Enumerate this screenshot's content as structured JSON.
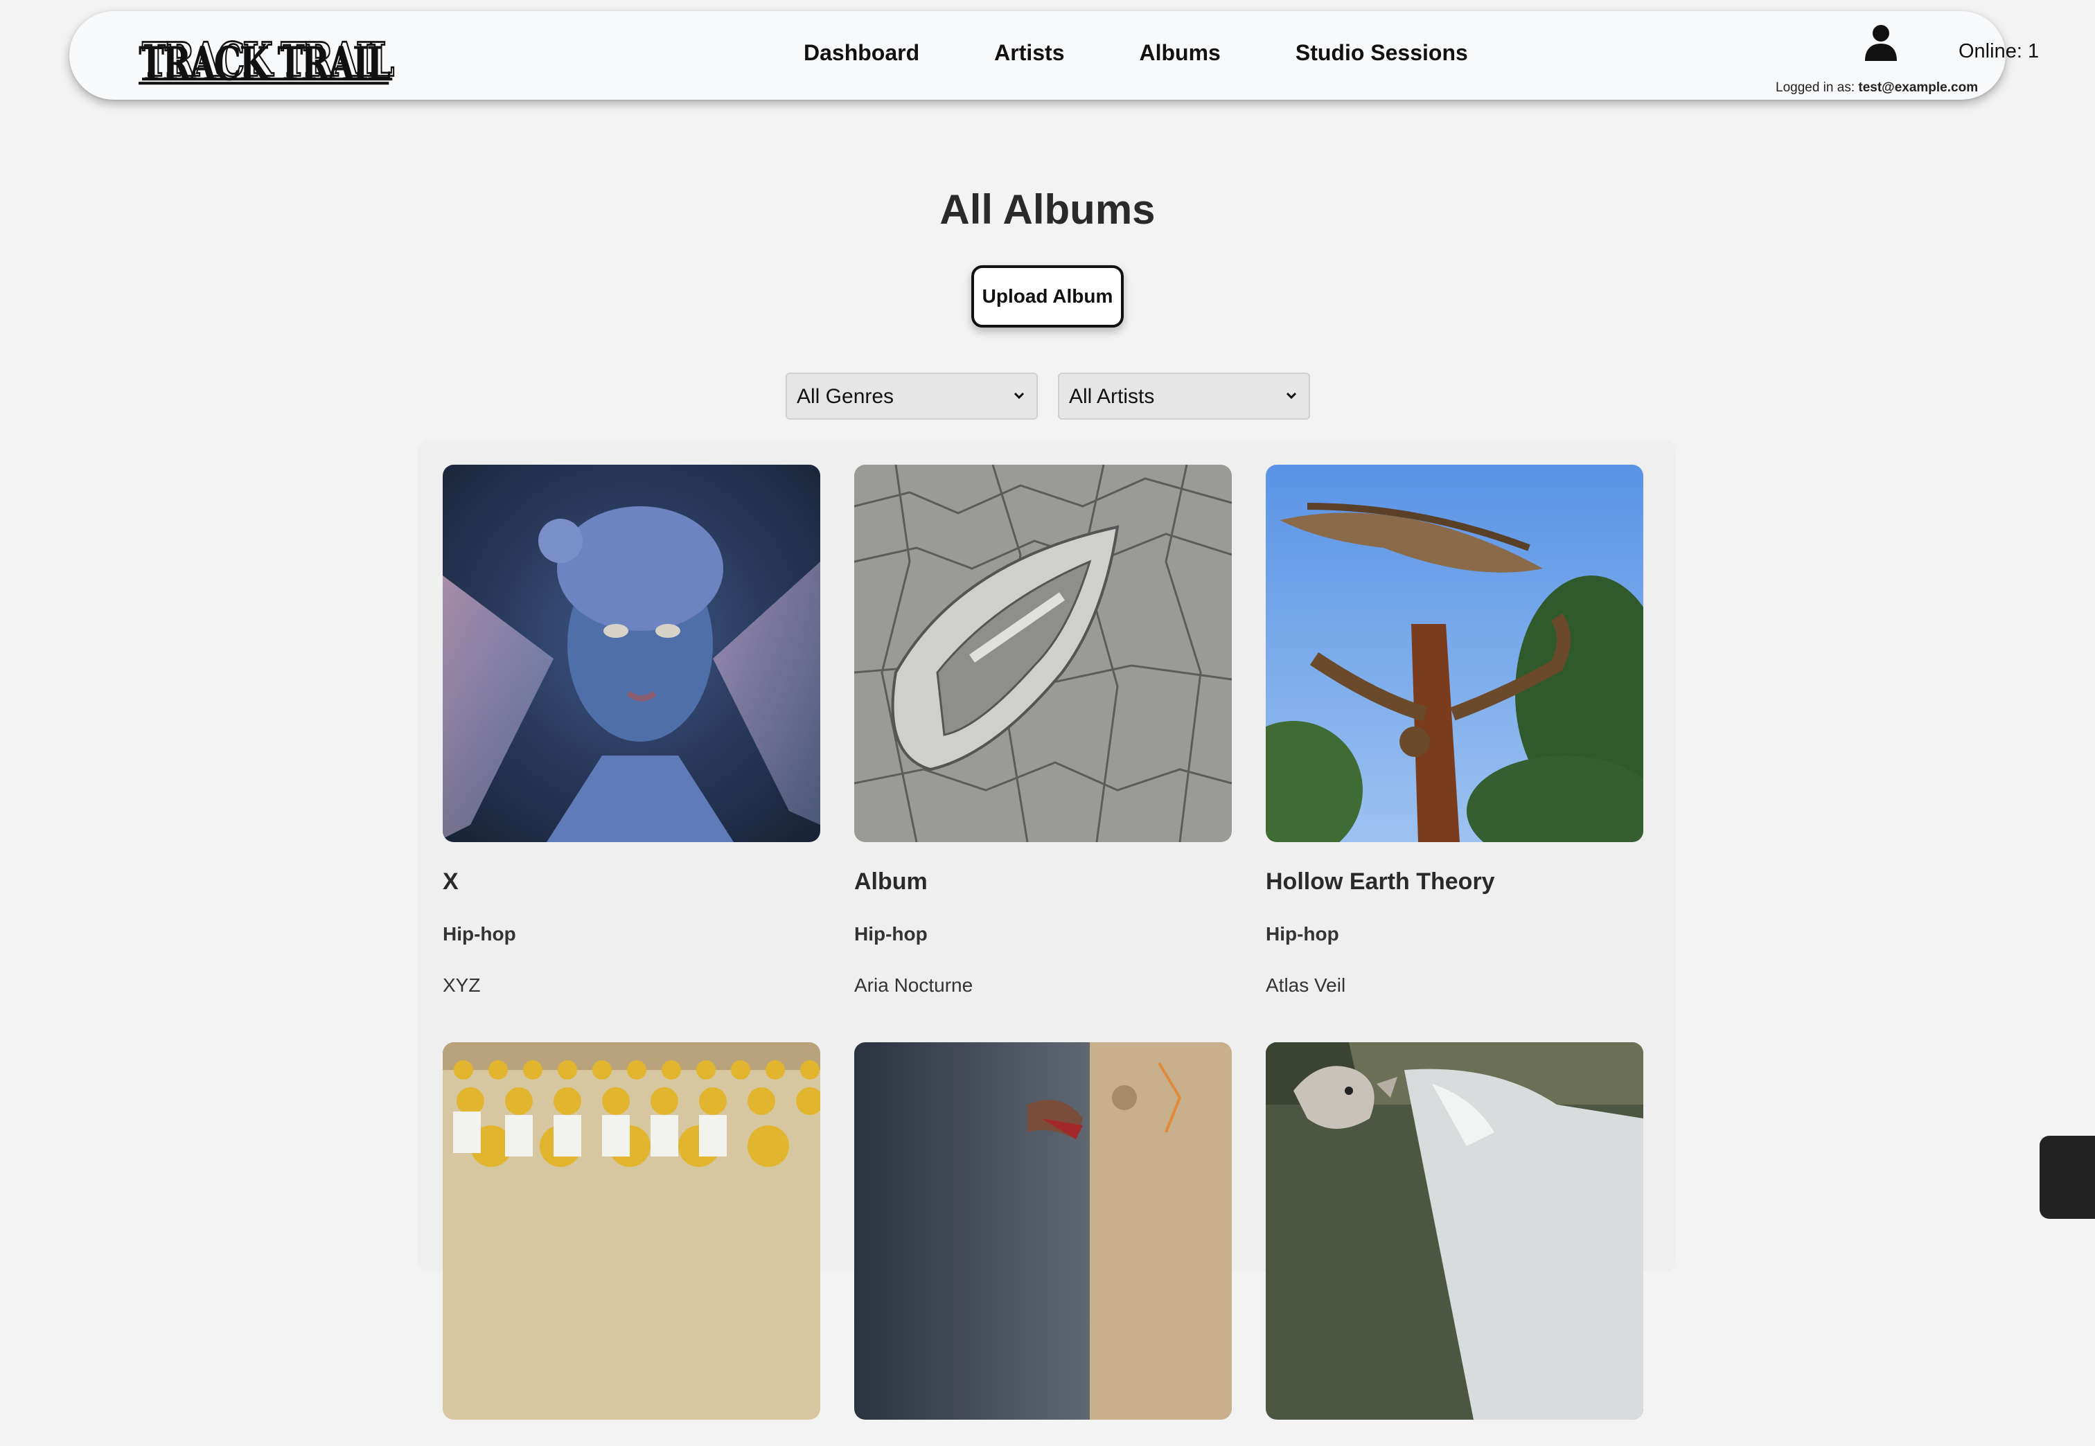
{
  "header": {
    "logo_text": "TRACK TRAIL",
    "nav": [
      "Dashboard",
      "Artists",
      "Albums",
      "Studio Sessions"
    ],
    "user_icon": "user-icon",
    "online_label": "Online: 1",
    "logged_prefix": "Logged in as:",
    "logged_email": "test@example.com"
  },
  "main": {
    "title": "All Albums",
    "upload_label": "Upload Album",
    "filters": {
      "genre_selected": "All Genres",
      "artist_selected": "All Artists"
    }
  },
  "albums": [
    {
      "title": "X",
      "genre": "Hip-hop",
      "artist": "XYZ",
      "cover": "fairy-cyborg-art"
    },
    {
      "title": "Album",
      "genre": "Hip-hop",
      "artist": "Aria Nocturne",
      "cover": "silver-boat-cracked-earth"
    },
    {
      "title": "Hollow Earth Theory",
      "genre": "Hip-hop",
      "artist": "Atlas Veil",
      "cover": "driftwood-sculpture-sky"
    },
    {
      "title": "",
      "genre": "",
      "artist": "",
      "cover": "lego-minifigure-army"
    },
    {
      "title": "",
      "genre": "",
      "artist": "",
      "cover": "blurred-wood-post"
    },
    {
      "title": "",
      "genre": "",
      "artist": "",
      "cover": "llama-waterfall"
    }
  ]
}
